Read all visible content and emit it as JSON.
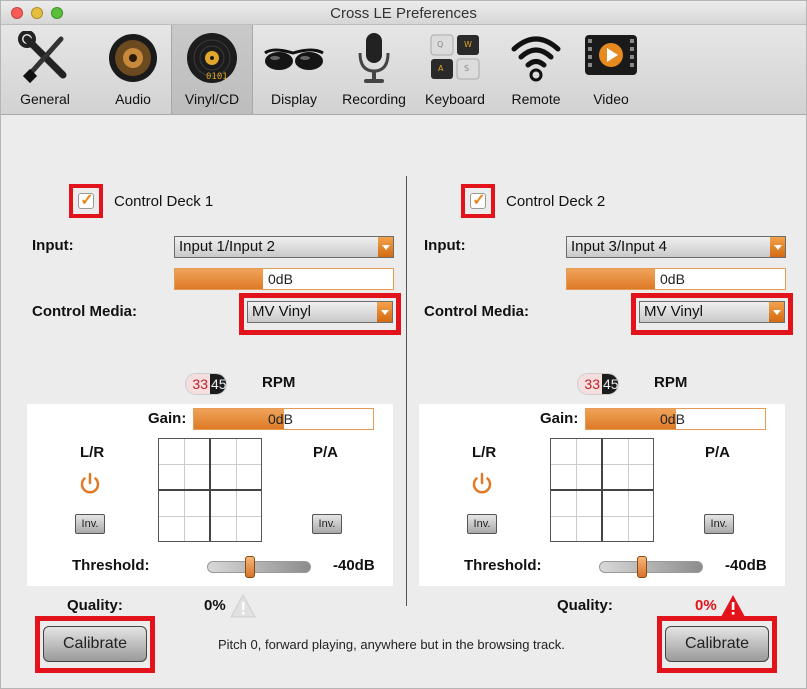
{
  "window": {
    "title": "Cross LE Preferences"
  },
  "toolbar": {
    "tabs": [
      {
        "label": "General",
        "icon": "wrench-screwdriver-icon"
      },
      {
        "label": "Audio",
        "icon": "speaker-icon"
      },
      {
        "label": "Vinyl/CD",
        "icon": "vinyl-cd-icon",
        "selected": true
      },
      {
        "label": "Display",
        "icon": "sunglasses-icon"
      },
      {
        "label": "Recording",
        "icon": "microphone-icon"
      },
      {
        "label": "Keyboard",
        "icon": "keyboard-keys-icon"
      },
      {
        "label": "Remote",
        "icon": "wifi-remote-icon"
      },
      {
        "label": "Video",
        "icon": "video-play-icon"
      }
    ]
  },
  "decks": [
    {
      "control_label": "Control Deck 1",
      "checked": true,
      "input_label": "Input:",
      "input_value": "Input 1/Input 2",
      "level_value": "0dB",
      "control_media_label": "Control Media:",
      "control_media_value": "MV Vinyl",
      "rpm_33": "33",
      "rpm_45": "45",
      "rpm_label": "RPM",
      "gain_label": "Gain:",
      "gain_value": "0dB",
      "lr_label": "L/R",
      "pa_label": "P/A",
      "inv_label": "Inv.",
      "threshold_label": "Threshold:",
      "threshold_value": "-40dB",
      "quality_label": "Quality:",
      "quality_value": "0%",
      "calibrate_label": "Calibrate"
    },
    {
      "control_label": "Control Deck 2",
      "checked": true,
      "input_label": "Input:",
      "input_value": "Input 3/Input 4",
      "level_value": "0dB",
      "control_media_label": "Control Media:",
      "control_media_value": "MV Vinyl",
      "rpm_33": "33",
      "rpm_45": "45",
      "rpm_label": "RPM",
      "gain_label": "Gain:",
      "gain_value": "0dB",
      "lr_label": "L/R",
      "pa_label": "P/A",
      "inv_label": "Inv.",
      "threshold_label": "Threshold:",
      "threshold_value": "-40dB",
      "quality_label": "Quality:",
      "quality_value": "0%",
      "calibrate_label": "Calibrate"
    }
  ],
  "hint": "Pitch 0, forward playing, anywhere but in the browsing track.",
  "colors": {
    "accent": "#e07a24",
    "highlight": "#e3131b",
    "quality_warning": "#e3131b"
  }
}
